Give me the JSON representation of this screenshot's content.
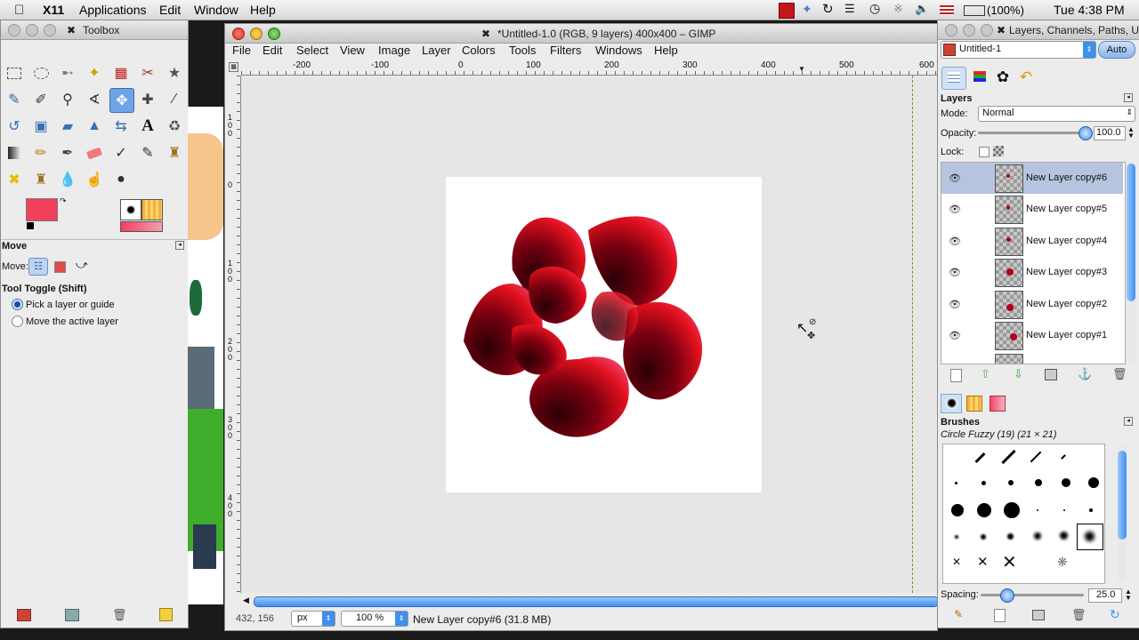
{
  "menubar": {
    "items": [
      "X11",
      "Applications",
      "Edit",
      "Window",
      "Help"
    ],
    "battery": "(100%)",
    "clock": "Tue 4:38 PM"
  },
  "toolbox": {
    "title": "Toolbox",
    "tool_options_title": "Move",
    "move_label": "Move:",
    "tool_toggle": "Tool Toggle  (Shift)",
    "radio_pick": "Pick a layer or guide",
    "radio_move_active": "Move the active layer",
    "fg_color": "#f0405a",
    "bg_color": "#ffffff"
  },
  "image_window": {
    "title": "*Untitled-1.0 (RGB, 9 layers) 400x400 – GIMP",
    "menu": [
      "File",
      "Edit",
      "Select",
      "View",
      "Image",
      "Layer",
      "Colors",
      "Tools",
      "Filters",
      "Windows",
      "Help"
    ],
    "ruler_top": [
      "-200",
      "-100",
      "0",
      "100",
      "200",
      "300",
      "400",
      "500",
      "600"
    ],
    "ruler_left": [
      "1",
      "0",
      "0",
      "0",
      "1",
      "0",
      "0",
      "2",
      "0",
      "0",
      "3",
      "0",
      "0",
      "4",
      "0",
      "0"
    ],
    "coords": "432, 156",
    "unit": "px",
    "zoom": "100 %",
    "status": "New Layer copy#6 (31.8 MB)"
  },
  "dock": {
    "title": "Layers, Channels, Paths, U",
    "image_select": "Untitled-1",
    "auto_button": "Auto",
    "layers": {
      "title": "Layers",
      "mode_label": "Mode:",
      "mode_value": "Normal",
      "opacity_label": "Opacity:",
      "opacity_value": "100.0",
      "opacity": 1.0,
      "lock_label": "Lock:",
      "items": [
        {
          "name": "New Layer copy#6"
        },
        {
          "name": "New Layer copy#5"
        },
        {
          "name": "New Layer copy#4"
        },
        {
          "name": "New Layer copy#3"
        },
        {
          "name": "New Layer copy#2"
        },
        {
          "name": "New Layer copy#1"
        }
      ]
    },
    "brushes": {
      "title": "Brushes",
      "current": "Circle Fuzzy (19) (21 × 21)",
      "spacing_label": "Spacing:",
      "spacing_value": "25.0",
      "spacing": 0.25
    }
  },
  "colors": {
    "accent_blue": "#3e8ff0",
    "flower_red": "#e0101e",
    "gradient_end": "#f2a0b0"
  }
}
